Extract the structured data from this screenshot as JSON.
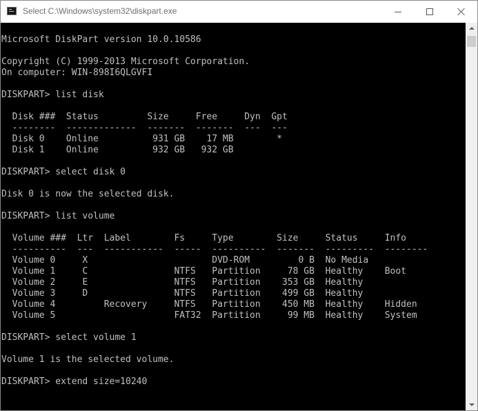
{
  "window": {
    "title": "Select C:\\Windows\\system32\\diskpart.exe",
    "icon": "console-app-icon"
  },
  "console": {
    "lines": [
      "Microsoft DiskPart version 10.0.10586",
      "",
      "Copyright (C) 1999-2013 Microsoft Corporation.",
      "On computer: WIN-898I6QLGVFI",
      "",
      "DISKPART> list disk",
      "",
      "  Disk ###  Status         Size     Free     Dyn  Gpt",
      "  --------  -------------  -------  -------  ---  ---",
      "  Disk 0    Online          931 GB    17 MB        *",
      "  Disk 1    Online          932 GB   932 GB",
      "",
      "DISKPART> select disk 0",
      "",
      "Disk 0 is now the selected disk.",
      "",
      "DISKPART> list volume",
      "",
      "  Volume ###  Ltr  Label        Fs     Type        Size     Status     Info",
      "  ----------  ---  -----------  -----  ----------  -------  ---------  --------",
      "  Volume 0     X                       DVD-ROM         0 B  No Media",
      "  Volume 1     C                NTFS   Partition     78 GB  Healthy    Boot",
      "  Volume 2     E                NTFS   Partition    353 GB  Healthy",
      "  Volume 3     D                NTFS   Partition    499 GB  Healthy",
      "  Volume 4         Recovery     NTFS   Partition    450 MB  Healthy    Hidden",
      "  Volume 5                      FAT32  Partition     99 MB  Healthy    System",
      "",
      "DISKPART> select volume 1",
      "",
      "Volume 1 is the selected volume.",
      "",
      "DISKPART> extend size=10240"
    ]
  }
}
